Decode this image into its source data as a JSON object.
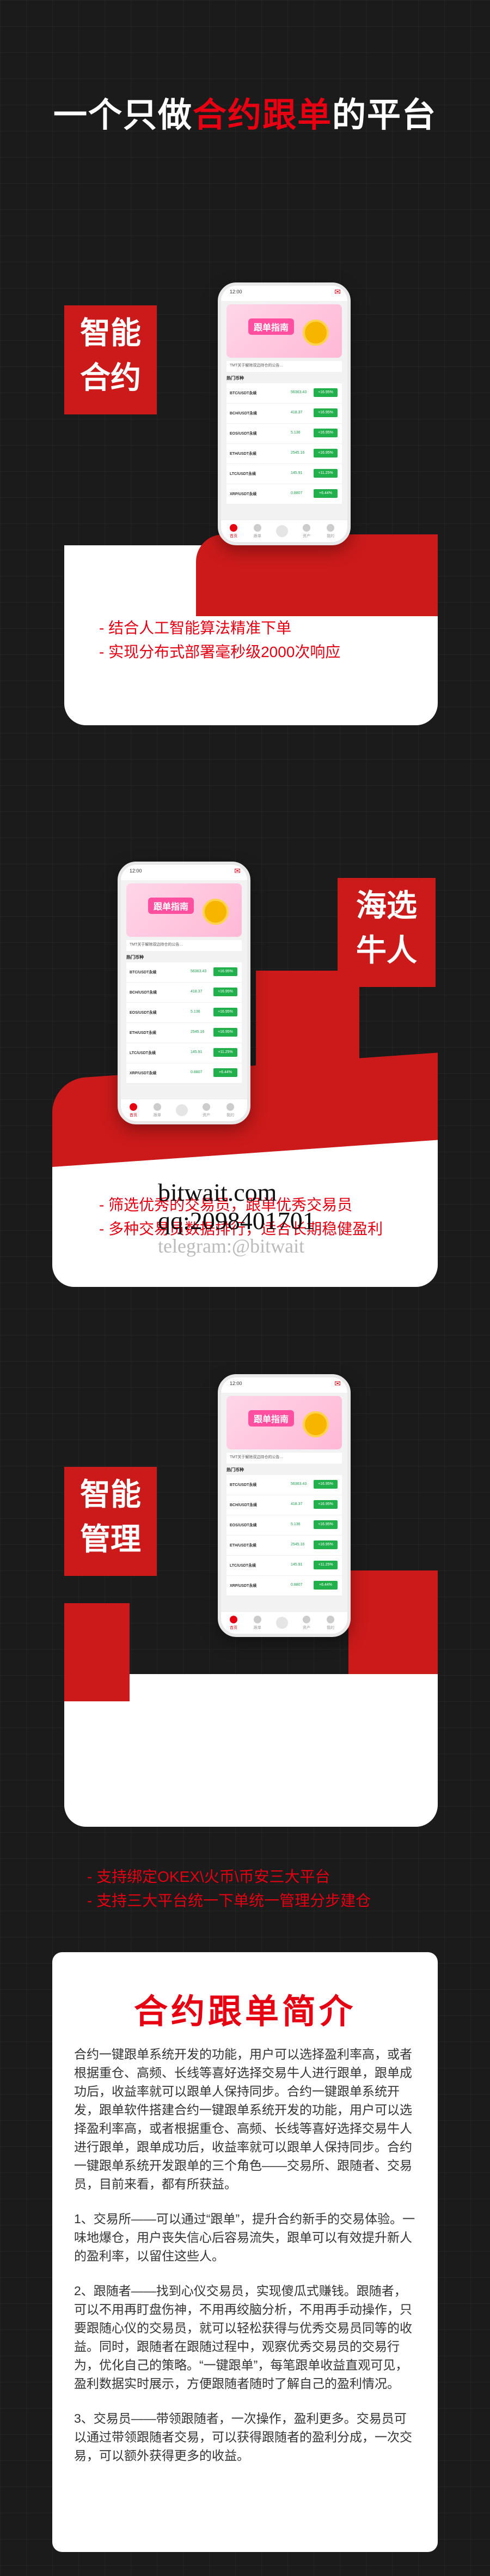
{
  "header": {
    "title_prefix": "一个只做",
    "title_highlight": "合约跟单",
    "title_suffix": "的平台"
  },
  "phone": {
    "banner_title": "跟单指南",
    "notice": "TMT关于解除双边持仓的公告…",
    "hot_title": "热门币种",
    "rows": [
      {
        "pair": "BTC/USDT永续",
        "price": "56363.43",
        "change": "+16.95%"
      },
      {
        "pair": "BCH/USDT永续",
        "price": "418.37",
        "change": "+16.95%"
      },
      {
        "pair": "EOS/USDT永续",
        "price": "5.136",
        "change": "+16.95%"
      },
      {
        "pair": "ETH/USDT永续",
        "price": "2545.16",
        "change": "+16.95%"
      },
      {
        "pair": "LTC/USDT永续",
        "price": "145.91",
        "change": "+11.25%"
      },
      {
        "pair": "XRP/USDT永续",
        "price": "0.8807",
        "change": "+6.44%"
      }
    ],
    "tabs": [
      "首页",
      "跟单",
      "",
      "资产",
      "我的"
    ],
    "status_time": "12:00"
  },
  "section1": {
    "tag_line1": "智能",
    "tag_line2": "合约",
    "bullets": [
      "结合人工智能算法精准下单",
      "实现分布式部署毫秒级2000次响应"
    ]
  },
  "section2": {
    "tag_line1": "海选",
    "tag_line2": "牛人",
    "bullets": [
      "筛选优秀的交易员，跟单优秀交易员",
      "多种交易员数据排行，适合长期稳健盈利"
    ]
  },
  "watermark": {
    "line1": "bitwait.com",
    "line2": "qq:2098401701",
    "line3": "telegram:@bitwait"
  },
  "section3": {
    "tag_line1": "智能",
    "tag_line2": "管理",
    "bullets": [
      "支持绑定OKEX\\火币\\币安三大平台",
      "支持三大平台统一下单统一管理分步建仓"
    ]
  },
  "intro": {
    "title": "合约跟单简介",
    "paragraphs": [
      "合约一键跟单系统开发的功能，用户可以选择盈利率高，或者根据重仓、高频、长线等喜好选择交易牛人进行跟单，跟单成功后，收益率就可以跟单人保持同步。合约一键跟单系统开发，跟单软件搭建合约一键跟单系统开发的功能，用户可以选择盈利率高，或者根据重仓、高频、长线等喜好选择交易牛人进行跟单，跟单成功后，收益率就可以跟单人保持同步。合约一键跟单系统开发跟单的三个角色——交易所、跟随者、交易员，目前来看，都有所获益。",
      "1、交易所——可以通过“跟单”，提升合约新手的交易体验。一味地爆仓，用户丧失信心后容易流失，跟单可以有效提升新人的盈利率，以留住这些人。",
      "2、跟随者——找到心仪交易员，实现傻瓜式赚钱。跟随者，可以不用再盯盘伤神，不用再绞脑分析，不用再手动操作，只要跟随心仪的交易员，就可以轻松获得与优秀交易员同等的收益。同时，跟随者在跟随过程中，观察优秀交易员的交易行为，优化自己的策略。“一键跟单”，每笔跟单收益直观可见，盈利数据实时展示，方便跟随者随时了解自己的盈利情况。",
      "3、交易员——带领跟随者，一次操作，盈利更多。交易员可以通过带领跟随者交易，可以获得跟随者的盈利分成，一次交易，可以额外获得更多的收益。"
    ]
  }
}
